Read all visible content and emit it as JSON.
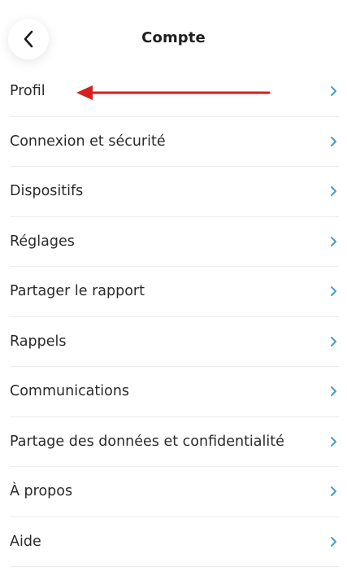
{
  "header": {
    "title": "Compte",
    "back_icon": "chevron-left-icon"
  },
  "menu": {
    "items": [
      {
        "label": "Profil"
      },
      {
        "label": "Connexion et sécurité"
      },
      {
        "label": "Dispositifs"
      },
      {
        "label": "Réglages"
      },
      {
        "label": "Partager le rapport"
      },
      {
        "label": "Rappels"
      },
      {
        "label": "Communications"
      },
      {
        "label": "Partage des données et confidentialité"
      },
      {
        "label": "À propos"
      },
      {
        "label": "Aide"
      }
    ],
    "chevron_icon": "chevron-right-icon",
    "chevron_color": "#3aa0d8"
  },
  "annotation": {
    "icon": "red-arrow-icon",
    "color": "#d42020",
    "points_to": "Profil"
  }
}
